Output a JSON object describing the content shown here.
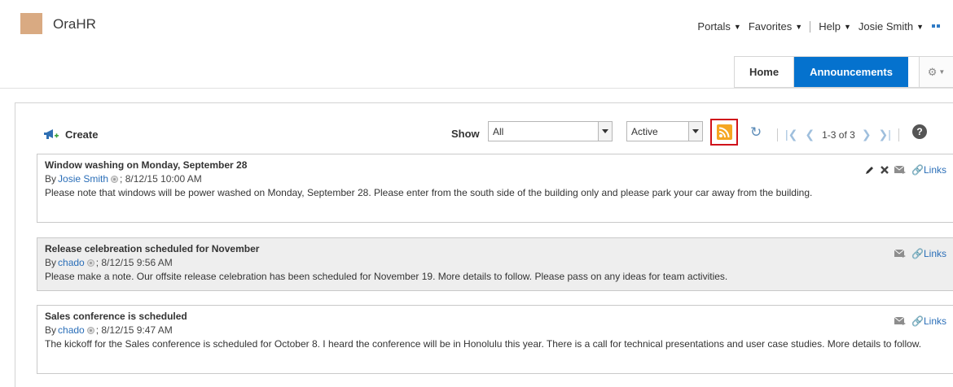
{
  "app": {
    "title": "OraHR",
    "logo_color": "#d9aa82"
  },
  "global_menu": {
    "items": [
      {
        "label": "Portals"
      },
      {
        "label": "Favorites"
      },
      {
        "label": "Help"
      },
      {
        "label": "Josie Smith"
      }
    ]
  },
  "nav": {
    "tabs": [
      {
        "label": "Home",
        "active": false
      },
      {
        "label": "Announcements",
        "active": true
      }
    ],
    "accent": "#0572ce"
  },
  "toolbar": {
    "create_label": "Create",
    "show_label": "Show",
    "filter_value": "All",
    "status_value": "Active",
    "pager_text": "1-3 of 3",
    "help_label": "?"
  },
  "announcements": [
    {
      "title": "Window washing on Monday, September 28",
      "by_prefix": "By",
      "author": "Josie Smith",
      "date": "; 8/12/15 10:00 AM",
      "body": "Please note that windows will be power washed on Monday, September 28. Please enter from the south side of the building only and please park your car away from the building.",
      "links_label": "Links"
    },
    {
      "title": "Release celebreation scheduled for November",
      "by_prefix": "By",
      "author": "chado",
      "date": "; 8/12/15 9:56 AM",
      "body": "Please make a note. Our offsite release celebration has been scheduled for November 19. More details to follow. Please pass on any ideas for team activities.",
      "links_label": "Links"
    },
    {
      "title": "Sales conference is scheduled",
      "by_prefix": "By",
      "author": "chado",
      "date": "; 8/12/15 9:47 AM",
      "body": "The kickoff for the Sales conference is scheduled for October 8. I heard the conference will be in Honolulu this year. There is a call for technical presentations and user case studies. More details to follow.",
      "links_label": "Links"
    }
  ]
}
